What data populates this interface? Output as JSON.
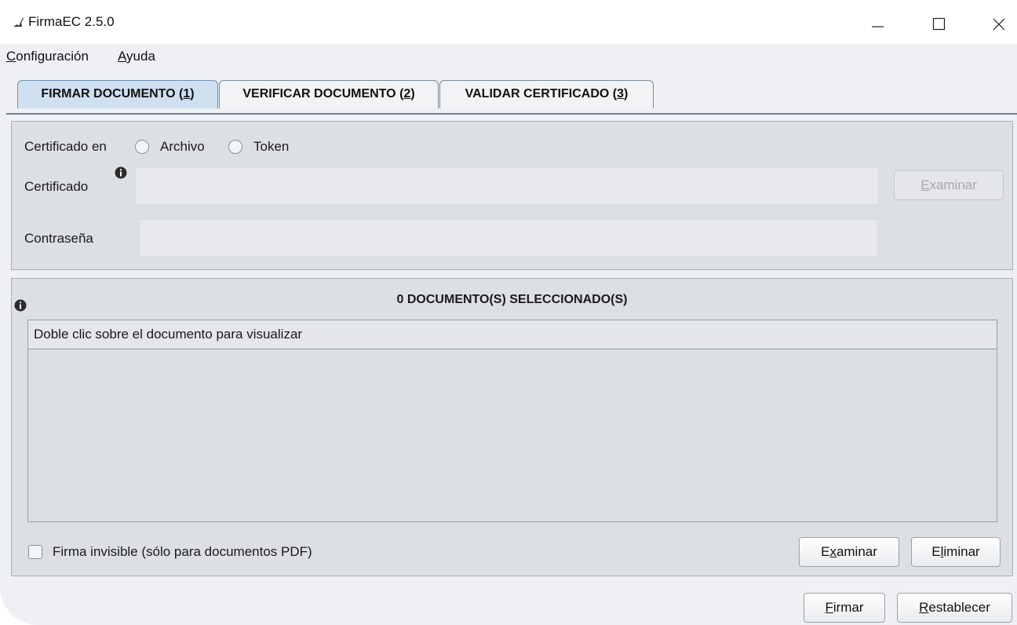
{
  "window": {
    "title": "FirmaEC 2.5.0"
  },
  "menu": {
    "configuracion": {
      "mnemonic": "C",
      "rest": "onfiguración"
    },
    "ayuda": {
      "mnemonic": "A",
      "rest": "yuda"
    }
  },
  "tabs": [
    {
      "prefix": "FIRMAR DOCUMENTO (",
      "num": "1",
      "suffix": ")",
      "active": true
    },
    {
      "prefix": "VERIFICAR DOCUMENTO (",
      "num": "2",
      "suffix": ")",
      "active": false
    },
    {
      "prefix": "VALIDAR CERTIFICADO (",
      "num": "3",
      "suffix": ")",
      "active": false
    }
  ],
  "certificate": {
    "source_label": "Certificado en",
    "options": [
      {
        "label": "Archivo",
        "selected": false
      },
      {
        "label": "Token",
        "selected": false
      }
    ],
    "certificate_label": "Certificado",
    "certificate_value": "",
    "browse": {
      "mnemonic": "E",
      "rest": "xaminar",
      "enabled": false
    },
    "password_label": "Contraseña",
    "password_value": ""
  },
  "documents": {
    "count_title": "0 DOCUMENTO(S) SELECCIONADO(S)",
    "list_header": "Doble clic sobre el documento para visualizar",
    "invisible_signature": {
      "label": "Firma invisible (sólo para documentos PDF)",
      "checked": false
    },
    "examinar": {
      "before": "E",
      "mnemonic": "x",
      "rest": "aminar"
    },
    "eliminar": {
      "before": "E",
      "mnemonic": "l",
      "rest": "iminar"
    }
  },
  "actions": {
    "firmar": {
      "mnemonic": "F",
      "rest": "irmar"
    },
    "restablecer": {
      "mnemonic": "R",
      "rest": "establecer"
    }
  },
  "colors": {
    "active_tab": "#cfe0f1",
    "panel_bg": "#dcdfe4",
    "window_bg": "#eef0f3"
  }
}
